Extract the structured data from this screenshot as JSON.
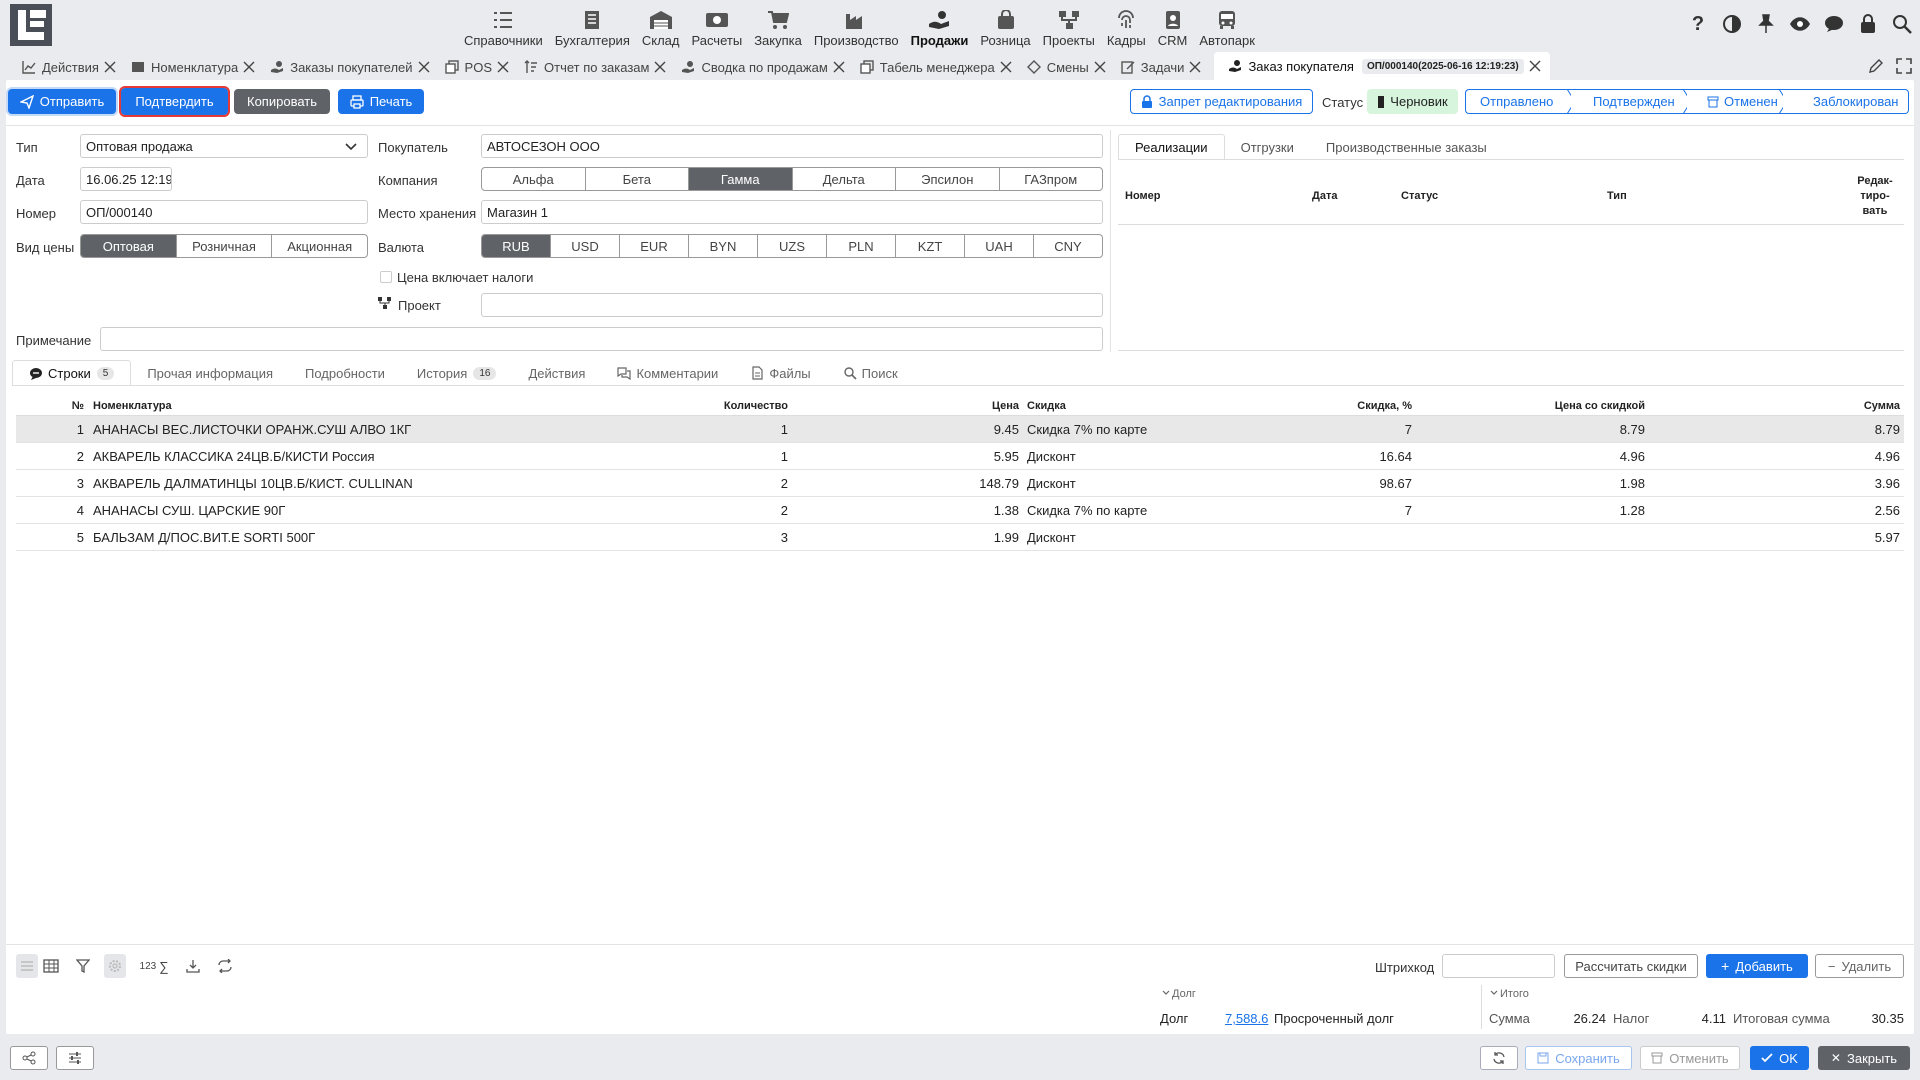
{
  "nav": {
    "modules": [
      {
        "label": "Справочники",
        "icon": "list-check-icon"
      },
      {
        "label": "Бухгалтерия",
        "icon": "ledger-icon"
      },
      {
        "label": "Склад",
        "icon": "warehouse-icon"
      },
      {
        "label": "Расчеты",
        "icon": "cash-icon"
      },
      {
        "label": "Закупка",
        "icon": "cart-icon"
      },
      {
        "label": "Производство",
        "icon": "factory-icon"
      },
      {
        "label": "Продажи",
        "icon": "hand-coins-icon"
      },
      {
        "label": "Розница",
        "icon": "bag-icon"
      },
      {
        "label": "Проекты",
        "icon": "project-tree-icon"
      },
      {
        "label": "Кадры",
        "icon": "fingerprint-icon"
      },
      {
        "label": "CRM",
        "icon": "contact-card-icon"
      },
      {
        "label": "Автопарк",
        "icon": "bus-icon"
      }
    ]
  },
  "tabs": [
    {
      "label": "Действия"
    },
    {
      "label": "Номенклатура"
    },
    {
      "label": "Заказы покупателей"
    },
    {
      "label": "POS"
    },
    {
      "label": "Отчет по заказам"
    },
    {
      "label": "Сводка по продажам"
    },
    {
      "label": "Табель менеджера"
    },
    {
      "label": "Смены"
    },
    {
      "label": "Задачи"
    },
    {
      "label": "Заказ покупателя",
      "badge": "ОП/000140(2025-06-16 12:19:23)"
    }
  ],
  "toolbar": {
    "send": "Отправить",
    "confirm": "Подтвердить",
    "copy": "Копировать",
    "print": "Печать",
    "lock_edit": "Запрет редактирования",
    "status_label": "Статус",
    "status_value": "Черновик"
  },
  "status_chain": [
    "Отправлено",
    "Подтвержден",
    "Отменен",
    "Заблокирован"
  ],
  "form": {
    "type_label": "Тип",
    "type_value": "Оптовая продажа",
    "date_label": "Дата",
    "date_value": "16.06.25 12:19",
    "number_label": "Номер",
    "number_value": "ОП/000140",
    "price_type_label": "Вид цены",
    "price_types": [
      "Оптовая",
      "Розничная",
      "Акционная"
    ],
    "customer_label": "Покупатель",
    "customer_value": "АВТОСЕЗОН ООО",
    "company_label": "Компания",
    "companies": [
      "Альфа",
      "Бета",
      "Гамма",
      "Дельта",
      "Эпсилон",
      "ГАЗпром"
    ],
    "storage_label": "Место хранения",
    "storage_value": "Магазин 1",
    "currency_label": "Валюта",
    "currencies": [
      "RUB",
      "USD",
      "EUR",
      "BYN",
      "UZS",
      "PLN",
      "KZT",
      "UAH",
      "CNY"
    ],
    "tax_checkbox": "Цена включает налоги",
    "project_label": "Проект",
    "note_label": "Примечание"
  },
  "right_panel": {
    "tabs": [
      "Реализации",
      "Отгрузки",
      "Производственные заказы"
    ],
    "headers": {
      "number": "Номер",
      "date": "Дата",
      "status": "Статус",
      "type": "Тип",
      "edit1": "Редак-",
      "edit2": "тиро-",
      "edit3": "вать"
    }
  },
  "lower_tabs": [
    {
      "label": "Строки",
      "badge": "5"
    },
    {
      "label": "Прочая информация"
    },
    {
      "label": "Подробности"
    },
    {
      "label": "История",
      "badge": "16"
    },
    {
      "label": "Действия"
    },
    {
      "label": "Комментарии"
    },
    {
      "label": "Файлы"
    },
    {
      "label": "Поиск"
    }
  ],
  "table": {
    "headers": {
      "num": "№",
      "item": "Номенклатура",
      "qty": "Количество",
      "price": "Цена",
      "discount": "Скидка",
      "discount_pct": "Скидка, %",
      "price_disc": "Цена со скидкой",
      "sum": "Сумма"
    },
    "rows": [
      {
        "num": "1",
        "item": "АНАНАСЫ ВЕС.ЛИСТОЧКИ ОРАНЖ.СУШ АЛВО 1КГ",
        "qty": "1",
        "price": "9.45",
        "discount": "Скидка 7% по карте",
        "discount_pct": "7",
        "price_disc": "8.79",
        "sum": "8.79"
      },
      {
        "num": "2",
        "item": "АКВАРЕЛЬ КЛАССИКА 24ЦВ.Б/КИСТИ Россия",
        "qty": "1",
        "price": "5.95",
        "discount": "Дисконт",
        "discount_pct": "16.64",
        "price_disc": "4.96",
        "sum": "4.96"
      },
      {
        "num": "3",
        "item": "АКВАРЕЛЬ ДАЛМАТИНЦЫ 10ЦВ.Б/КИСТ. CULLINAN",
        "qty": "2",
        "price": "148.79",
        "discount": "Дисконт",
        "discount_pct": "98.67",
        "price_disc": "1.98",
        "sum": "3.96"
      },
      {
        "num": "4",
        "item": "АНАНАСЫ СУШ. ЦАРСКИЕ 90Г",
        "qty": "2",
        "price": "1.38",
        "discount": "Скидка 7% по карте",
        "discount_pct": "7",
        "price_disc": "1.28",
        "sum": "2.56"
      },
      {
        "num": "5",
        "item": "БАЛЬЗАМ Д/ПОС.ВИТ.Е SORTI 500Г",
        "qty": "3",
        "price": "1.99",
        "discount": "Дисконт",
        "discount_pct": "",
        "price_disc": "",
        "sum": "5.97"
      }
    ]
  },
  "grid_toolbar": {
    "count_label": "123",
    "barcode_label": "Штрихкод",
    "calc_discounts": "Рассчитать скидки",
    "add": "Добавить",
    "delete": "Удалить"
  },
  "summary": {
    "debt_header": "Долг",
    "debt_label": "Долг",
    "debt_value": "7,588.6",
    "overdue_label": "Просроченный долг",
    "total_header": "Итого",
    "sum_label": "Сумма",
    "sum_value": "26.24",
    "tax_label": "Налог",
    "tax_value": "4.11",
    "total_label": "Итоговая сумма",
    "total_value": "30.35"
  },
  "footer": {
    "save": "Сохранить",
    "cancel": "Отменить",
    "ok": "OK",
    "close": "Закрыть"
  },
  "colors": {
    "accent": "#1a73e8",
    "highlight_border": "#e53935",
    "status_draft_bg": "#d7f5dd",
    "dark_btn": "#5f6368"
  }
}
